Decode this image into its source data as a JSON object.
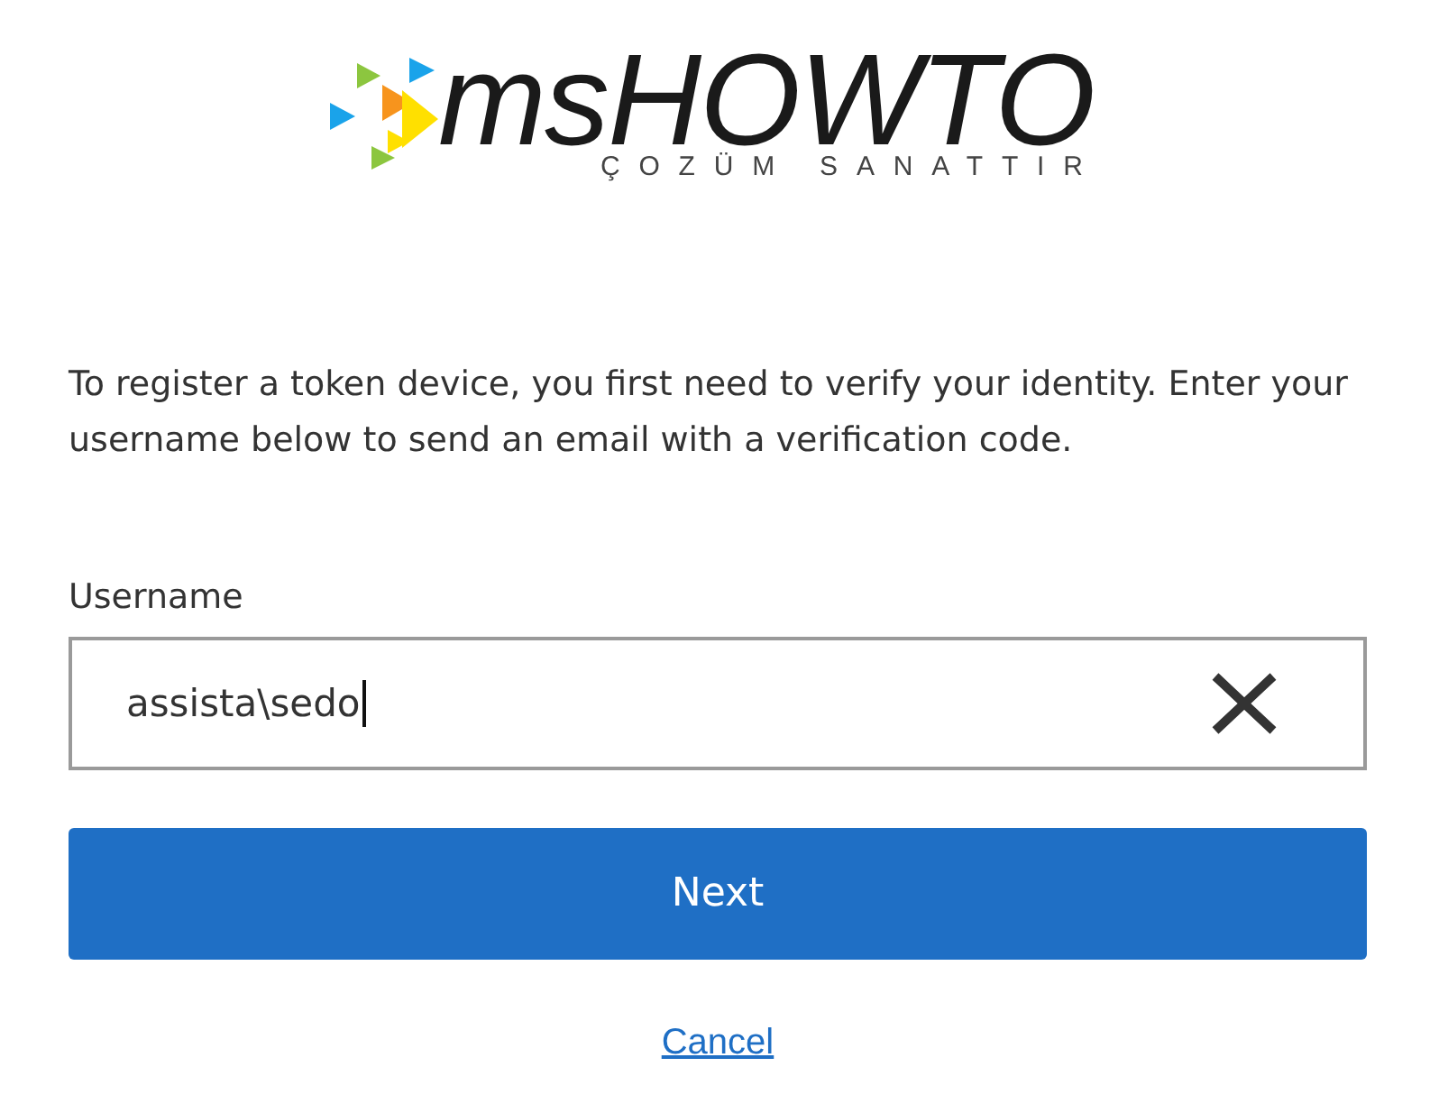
{
  "logo": {
    "wordmark": "msHOWTO",
    "tagline": "ÇOZÜM SANATTIR"
  },
  "instructions": "To register a token device, you first need to verify your identity. Enter your username below to send an email with a verification code.",
  "username": {
    "label": "Username",
    "value": "assista\\sedo",
    "focused": true
  },
  "next_button": {
    "label": "Next"
  },
  "cancel_link": {
    "label": "Cancel"
  }
}
